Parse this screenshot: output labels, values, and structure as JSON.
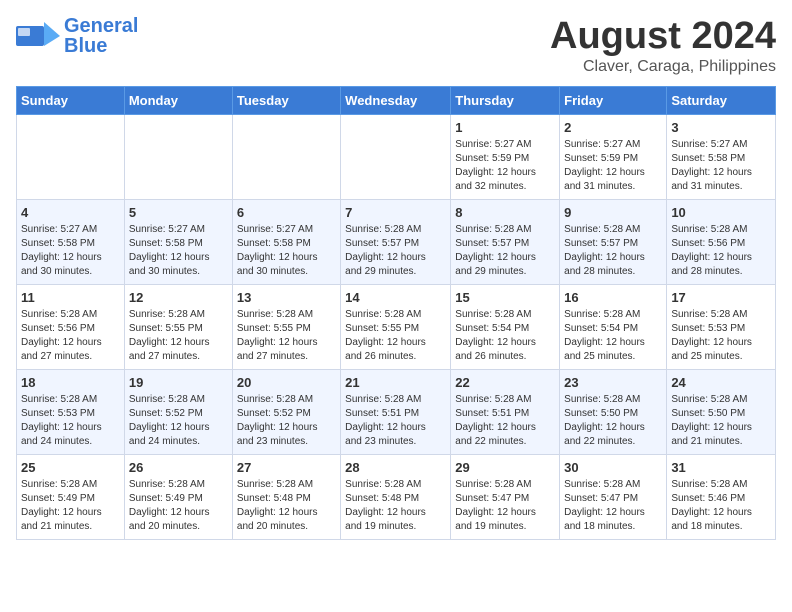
{
  "header": {
    "logo_line1": "General",
    "logo_line2": "Blue",
    "month_year": "August 2024",
    "location": "Claver, Caraga, Philippines"
  },
  "days_of_week": [
    "Sunday",
    "Monday",
    "Tuesday",
    "Wednesday",
    "Thursday",
    "Friday",
    "Saturday"
  ],
  "weeks": [
    {
      "days": [
        {
          "num": "",
          "info": ""
        },
        {
          "num": "",
          "info": ""
        },
        {
          "num": "",
          "info": ""
        },
        {
          "num": "",
          "info": ""
        },
        {
          "num": "1",
          "info": "Sunrise: 5:27 AM\nSunset: 5:59 PM\nDaylight: 12 hours\nand 32 minutes."
        },
        {
          "num": "2",
          "info": "Sunrise: 5:27 AM\nSunset: 5:59 PM\nDaylight: 12 hours\nand 31 minutes."
        },
        {
          "num": "3",
          "info": "Sunrise: 5:27 AM\nSunset: 5:58 PM\nDaylight: 12 hours\nand 31 minutes."
        }
      ]
    },
    {
      "days": [
        {
          "num": "4",
          "info": "Sunrise: 5:27 AM\nSunset: 5:58 PM\nDaylight: 12 hours\nand 30 minutes."
        },
        {
          "num": "5",
          "info": "Sunrise: 5:27 AM\nSunset: 5:58 PM\nDaylight: 12 hours\nand 30 minutes."
        },
        {
          "num": "6",
          "info": "Sunrise: 5:27 AM\nSunset: 5:58 PM\nDaylight: 12 hours\nand 30 minutes."
        },
        {
          "num": "7",
          "info": "Sunrise: 5:28 AM\nSunset: 5:57 PM\nDaylight: 12 hours\nand 29 minutes."
        },
        {
          "num": "8",
          "info": "Sunrise: 5:28 AM\nSunset: 5:57 PM\nDaylight: 12 hours\nand 29 minutes."
        },
        {
          "num": "9",
          "info": "Sunrise: 5:28 AM\nSunset: 5:57 PM\nDaylight: 12 hours\nand 28 minutes."
        },
        {
          "num": "10",
          "info": "Sunrise: 5:28 AM\nSunset: 5:56 PM\nDaylight: 12 hours\nand 28 minutes."
        }
      ]
    },
    {
      "days": [
        {
          "num": "11",
          "info": "Sunrise: 5:28 AM\nSunset: 5:56 PM\nDaylight: 12 hours\nand 27 minutes."
        },
        {
          "num": "12",
          "info": "Sunrise: 5:28 AM\nSunset: 5:55 PM\nDaylight: 12 hours\nand 27 minutes."
        },
        {
          "num": "13",
          "info": "Sunrise: 5:28 AM\nSunset: 5:55 PM\nDaylight: 12 hours\nand 27 minutes."
        },
        {
          "num": "14",
          "info": "Sunrise: 5:28 AM\nSunset: 5:55 PM\nDaylight: 12 hours\nand 26 minutes."
        },
        {
          "num": "15",
          "info": "Sunrise: 5:28 AM\nSunset: 5:54 PM\nDaylight: 12 hours\nand 26 minutes."
        },
        {
          "num": "16",
          "info": "Sunrise: 5:28 AM\nSunset: 5:54 PM\nDaylight: 12 hours\nand 25 minutes."
        },
        {
          "num": "17",
          "info": "Sunrise: 5:28 AM\nSunset: 5:53 PM\nDaylight: 12 hours\nand 25 minutes."
        }
      ]
    },
    {
      "days": [
        {
          "num": "18",
          "info": "Sunrise: 5:28 AM\nSunset: 5:53 PM\nDaylight: 12 hours\nand 24 minutes."
        },
        {
          "num": "19",
          "info": "Sunrise: 5:28 AM\nSunset: 5:52 PM\nDaylight: 12 hours\nand 24 minutes."
        },
        {
          "num": "20",
          "info": "Sunrise: 5:28 AM\nSunset: 5:52 PM\nDaylight: 12 hours\nand 23 minutes."
        },
        {
          "num": "21",
          "info": "Sunrise: 5:28 AM\nSunset: 5:51 PM\nDaylight: 12 hours\nand 23 minutes."
        },
        {
          "num": "22",
          "info": "Sunrise: 5:28 AM\nSunset: 5:51 PM\nDaylight: 12 hours\nand 22 minutes."
        },
        {
          "num": "23",
          "info": "Sunrise: 5:28 AM\nSunset: 5:50 PM\nDaylight: 12 hours\nand 22 minutes."
        },
        {
          "num": "24",
          "info": "Sunrise: 5:28 AM\nSunset: 5:50 PM\nDaylight: 12 hours\nand 21 minutes."
        }
      ]
    },
    {
      "days": [
        {
          "num": "25",
          "info": "Sunrise: 5:28 AM\nSunset: 5:49 PM\nDaylight: 12 hours\nand 21 minutes."
        },
        {
          "num": "26",
          "info": "Sunrise: 5:28 AM\nSunset: 5:49 PM\nDaylight: 12 hours\nand 20 minutes."
        },
        {
          "num": "27",
          "info": "Sunrise: 5:28 AM\nSunset: 5:48 PM\nDaylight: 12 hours\nand 20 minutes."
        },
        {
          "num": "28",
          "info": "Sunrise: 5:28 AM\nSunset: 5:48 PM\nDaylight: 12 hours\nand 19 minutes."
        },
        {
          "num": "29",
          "info": "Sunrise: 5:28 AM\nSunset: 5:47 PM\nDaylight: 12 hours\nand 19 minutes."
        },
        {
          "num": "30",
          "info": "Sunrise: 5:28 AM\nSunset: 5:47 PM\nDaylight: 12 hours\nand 18 minutes."
        },
        {
          "num": "31",
          "info": "Sunrise: 5:28 AM\nSunset: 5:46 PM\nDaylight: 12 hours\nand 18 minutes."
        }
      ]
    }
  ]
}
